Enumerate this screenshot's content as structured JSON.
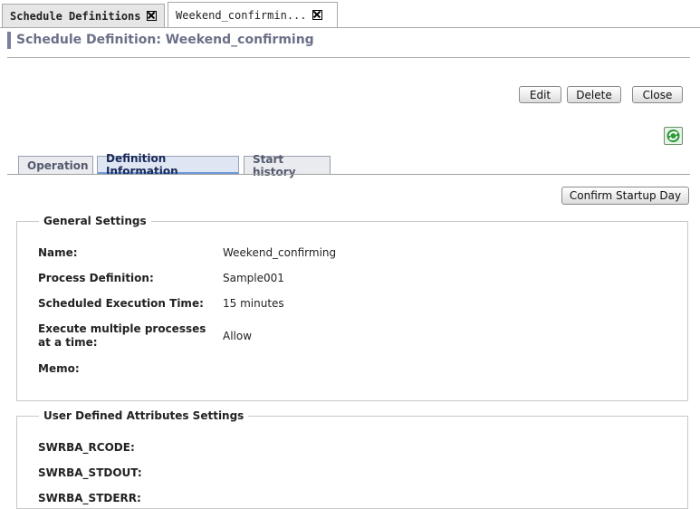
{
  "top_tabs": [
    {
      "label": "Schedule Definitions",
      "active": false
    },
    {
      "label": "Weekend_confirmin...",
      "active": true
    }
  ],
  "page_title": "Schedule Definition: Weekend_confirming",
  "actions": {
    "edit": "Edit",
    "delete": "Delete",
    "close": "Close"
  },
  "refresh_icon": "refresh-icon",
  "inner_tabs": [
    {
      "label": "Operation",
      "active": false
    },
    {
      "label": "Definition Information",
      "active": true
    },
    {
      "label": "Start history",
      "active": false
    }
  ],
  "confirm_button": "Confirm Startup Day",
  "general_settings": {
    "legend": "General Settings",
    "rows": [
      {
        "label": "Name:",
        "value": "Weekend_confirming"
      },
      {
        "label": "Process Definition:",
        "value": "Sample001"
      },
      {
        "label": "Scheduled Execution Time:",
        "value": "15 minutes"
      },
      {
        "label": "Execute multiple processes at a time:",
        "value": "Allow"
      },
      {
        "label": "Memo:",
        "value": ""
      }
    ]
  },
  "user_attributes": {
    "legend": "User Defined Attributes Settings",
    "rows": [
      {
        "label": "SWRBA_RCODE:",
        "value": ""
      },
      {
        "label": "SWRBA_STDOUT:",
        "value": ""
      },
      {
        "label": "SWRBA_STDERR:",
        "value": ""
      }
    ]
  },
  "colors": {
    "accent_blue": "#6f9ad6",
    "title_gray": "#6b7088",
    "refresh_green": "#2e9a3a"
  }
}
